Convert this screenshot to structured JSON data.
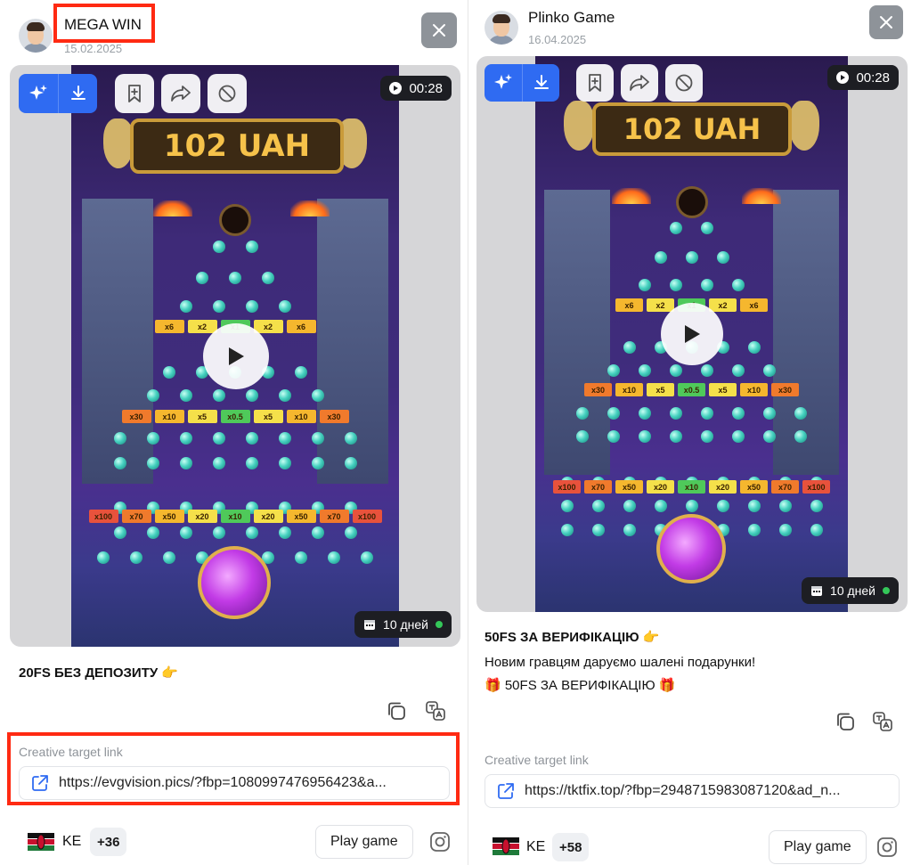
{
  "card_a": {
    "name": "MEGA WIN",
    "date": "15.02.2025",
    "timer": "00:28",
    "banner": "102 UAH",
    "days": "10 дней",
    "caption": "20FS БЕЗ ДЕПОЗИТУ 👉",
    "link_label": "Creative target link",
    "link_url": "https://evgvision.pics/?fbp=1080997476956423&a...",
    "country": "KE",
    "more": "+36",
    "cta": "Play game"
  },
  "card_b": {
    "name": "Plinko Game",
    "date": "16.04.2025",
    "timer": "00:28",
    "banner": "102 UAH",
    "days": "10 дней",
    "caption": "50FS ЗА ВЕРИФІКАЦІЮ 👉",
    "body_line1": "Новим гравцям даруємо шалені подарунки!",
    "body_line2": "🎁 50FS ЗА ВЕРИФІКАЦІЮ 🎁",
    "link_label": "Creative target link",
    "link_url": "https://tktfix.top/?fbp=2948715983087120&ad_n...",
    "country": "KE",
    "more": "+58",
    "cta": "Play game"
  },
  "multipliers": {
    "top": [
      "x6",
      "x2",
      "x1",
      "x2",
      "x6"
    ],
    "middle": [
      "x30",
      "x10",
      "x5",
      "x0.5",
      "x5",
      "x10",
      "x30"
    ],
    "bottom": [
      "x100",
      "x70",
      "x50",
      "x20",
      "x10",
      "x20",
      "x50",
      "x70",
      "x100"
    ]
  },
  "colors": {
    "highlight": "#ff2a12",
    "accent_blue": "#2f6bf2",
    "dark_chip": "#1d1e23",
    "status_green": "#34c759"
  },
  "icons": [
    "ai-sparkle-icon",
    "download-icon",
    "bookmark-add-icon",
    "share-icon",
    "block-icon",
    "play-icon",
    "calendar-icon",
    "close-icon",
    "copy-icon",
    "translate-icon",
    "external-link-icon",
    "kenya-flag-icon",
    "instagram-icon"
  ]
}
